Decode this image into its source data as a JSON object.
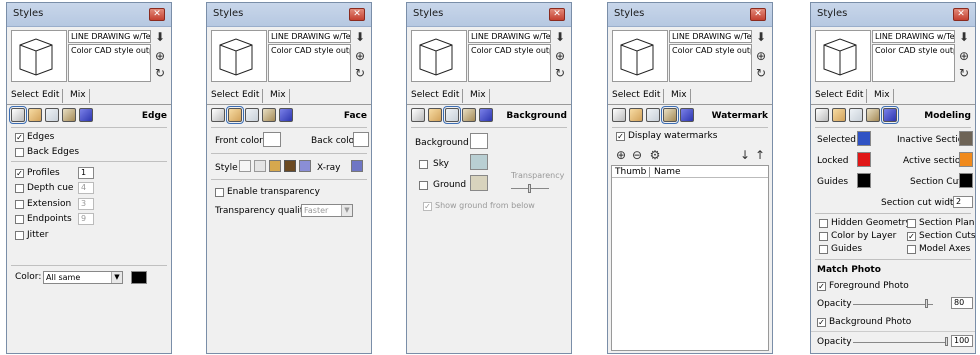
{
  "panels": [
    {
      "title": "Styles",
      "name": "LINE DRAWING w/Textu",
      "desc": "Color CAD style output.",
      "tabs": [
        "Select",
        "Edit",
        "Mix"
      ],
      "section": "Edge"
    },
    {
      "title": "Styles",
      "name": "LINE DRAWING w/Textu",
      "desc": "Color CAD style output.",
      "tabs": [
        "Select",
        "Edit",
        "Mix"
      ],
      "section": "Face"
    },
    {
      "title": "Styles",
      "name": "LINE DRAWING w/Textu",
      "desc": "Color CAD style output.",
      "tabs": [
        "Select",
        "Edit",
        "Mix"
      ],
      "section": "Background"
    },
    {
      "title": "Styles",
      "name": "LINE DRAWING w/Textu",
      "desc": "Color CAD style output.",
      "tabs": [
        "Select",
        "Edit",
        "Mix"
      ],
      "section": "Watermark"
    },
    {
      "title": "Styles",
      "name": "LINE DRAWING w/Textu",
      "desc": "Color CAD style output.",
      "tabs": [
        "Select",
        "Edit",
        "Mix"
      ],
      "section": "Modeling"
    }
  ],
  "edge": {
    "edges": "Edges",
    "back_edges": "Back Edges",
    "profiles": "Profiles",
    "profiles_val": "1",
    "depth_cue": "Depth cue",
    "depth_val": "4",
    "extension": "Extension",
    "extension_val": "3",
    "endpoints": "Endpoints",
    "endpoints_val": "9",
    "jitter": "Jitter",
    "color_label": "Color:",
    "color_value": "All same"
  },
  "face": {
    "front": "Front color",
    "back": "Back color",
    "style": "Style",
    "xray": "X-ray",
    "enable_transparency": "Enable transparency",
    "tq_label": "Transparency quality:",
    "tq_value": "Faster"
  },
  "background": {
    "background": "Background",
    "sky": "Sky",
    "ground": "Ground",
    "transparency": "Transparency",
    "show_ground": "Show ground from below"
  },
  "watermark": {
    "display": "Display watermarks",
    "col_thumb": "Thumb",
    "col_name": "Name"
  },
  "modeling": {
    "selected": "Selected",
    "locked": "Locked",
    "guides": "Guides",
    "inactive_section": "Inactive Section",
    "active_section": "Active section",
    "section_cuts": "Section Cuts",
    "cut_width_label": "Section cut width",
    "cut_width_val": "2",
    "hidden_geometry": "Hidden Geometry",
    "color_by_layer": "Color by Layer",
    "guides_cb": "Guides",
    "section_planes": "Section Planes",
    "section_cuts_cb": "Section Cuts",
    "model_axes": "Model Axes",
    "match_photo": "Match Photo",
    "foreground_photo": "Foreground Photo",
    "opacity": "Opacity",
    "fg_val": "80",
    "background_photo": "Background Photo",
    "bg_val": "100"
  },
  "colors": {
    "selected": "#2f52c4",
    "locked": "#e01616",
    "guides": "#000000",
    "inactive": "#6d6356",
    "active": "#f08a1c",
    "cuts": "#000000",
    "sky": "#b9cfd3",
    "ground": "#d8d3bd"
  }
}
